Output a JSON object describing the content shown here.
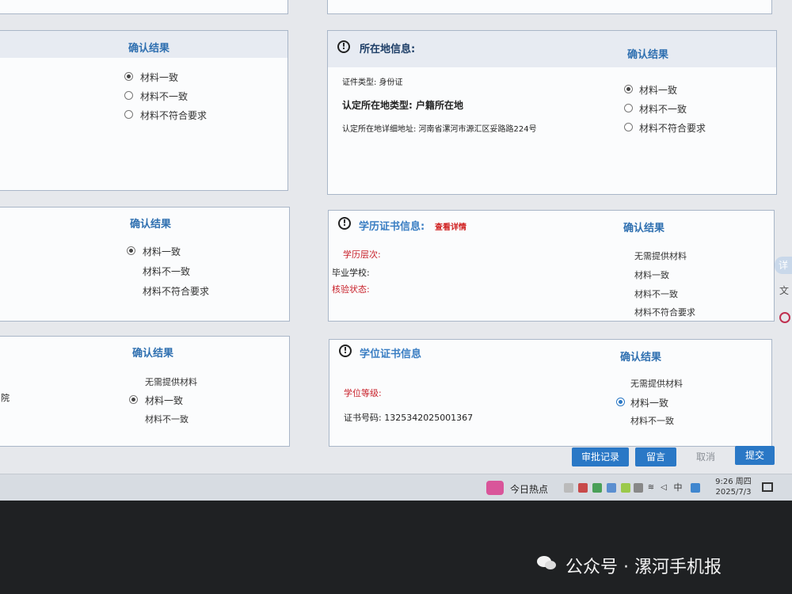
{
  "cards": {
    "left_top": {
      "confirm_title": "确认结果",
      "options": [
        "材料一致",
        "材料不一致",
        "材料不符合要求"
      ]
    },
    "residence": {
      "warn_icon": "exclamation-circle-icon",
      "title": "所在地信息:",
      "confirm_title": "确认结果",
      "id_type": "证件类型: 身份证",
      "residence_type": "认定所在地类型: 户籍所在地",
      "address": "认定所在地详细地址: 河南省漯河市源汇区妥路路224号",
      "options": [
        "材料一致",
        "材料不一致",
        "材料不符合要求"
      ]
    },
    "left_mid": {
      "confirm_title": "确认结果",
      "options": [
        "材料一致",
        "材料不一致",
        "材料不符合要求"
      ]
    },
    "education": {
      "warn_icon": "exclamation-circle-icon",
      "title": "学历证书信息:",
      "link": "查看详情",
      "confirm_title": "确认结果",
      "level_label": "学历层次:",
      "school_label": "毕业学校:",
      "status_label": "核验状态:",
      "options": [
        "无需提供材料",
        "材料一致",
        "材料不一致",
        "材料不符合要求"
      ]
    },
    "left_bottom": {
      "confirm_title": "确认结果",
      "side_text": "院",
      "options": [
        "无需提供材料",
        "材料一致",
        "材料不一致"
      ]
    },
    "degree": {
      "warn_icon": "exclamation-circle-icon",
      "title": "学位证书信息",
      "confirm_title": "确认结果",
      "grade_label": "学位等级:",
      "cert_no": "证书号码: 1325342025001367",
      "options": [
        "无需提供材料",
        "材料一致",
        "材料不一致"
      ]
    }
  },
  "actions": {
    "history": "审批记录",
    "message": "留言",
    "cancel": "取消",
    "submit": "提交"
  },
  "taskbar": {
    "news": "今日热点",
    "ime": "中",
    "time": "9:26 周四",
    "date": "2025/7/3"
  },
  "right_strip": {
    "tab": "详"
  },
  "watermark": "公众号 · 漯河手机报",
  "colors": {
    "accent": "#2a78c6",
    "warning_red": "#c8202a",
    "card_border": "#a9b6c8"
  }
}
